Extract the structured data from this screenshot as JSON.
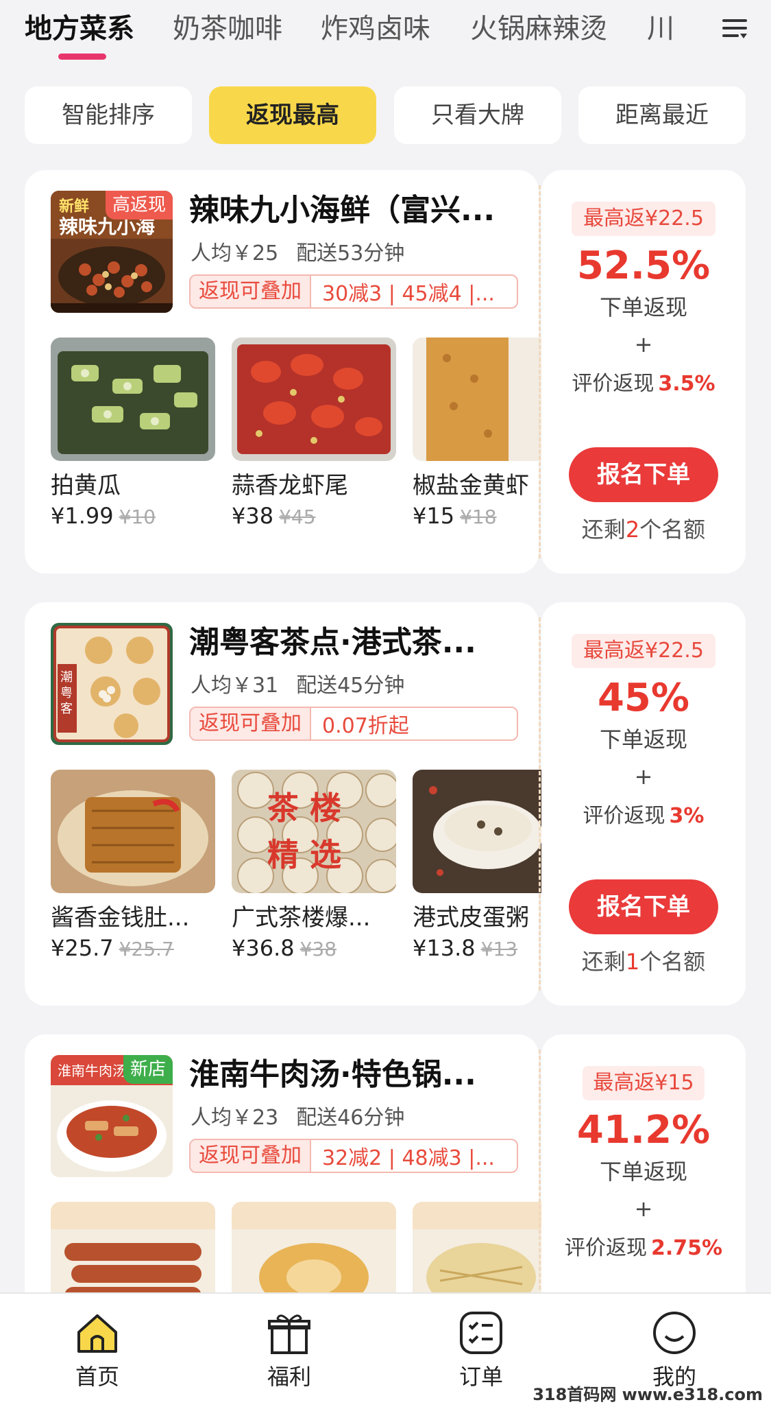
{
  "category_tabs": [
    {
      "label": "地方菜系",
      "active": true
    },
    {
      "label": "奶茶咖啡",
      "active": false
    },
    {
      "label": "炸鸡卤味",
      "active": false
    },
    {
      "label": "火锅麻辣烫",
      "active": false
    },
    {
      "label": "川",
      "active": false
    }
  ],
  "sort_chips": [
    {
      "label": "智能排序",
      "active": false
    },
    {
      "label": "返现最高",
      "active": true
    },
    {
      "label": "只看大牌",
      "active": false
    },
    {
      "label": "距离最近",
      "active": false
    }
  ],
  "stores": [
    {
      "badge": "高返现",
      "name": "辣味九小海鲜（富兴...",
      "avg_price": "人均￥25",
      "delivery": "配送53分钟",
      "promo_tag": "返现可叠加",
      "promo_text": "30减3 | 45减4 |...",
      "dishes": [
        {
          "name": "拍黄瓜",
          "price": "¥1.99",
          "orig": "¥10"
        },
        {
          "name": "蒜香龙虾尾",
          "price": "¥38",
          "orig": "¥45"
        },
        {
          "name": "椒盐金黄虾",
          "price": "¥15",
          "orig": "¥18"
        }
      ],
      "max_return": "最高返¥22.5",
      "rate": "52.5%",
      "rate_label": "下单返现",
      "plus": "+",
      "review_label": "评价返现",
      "review_pct": "3.5%",
      "signup_label": "报名下单",
      "quota_prefix": "还剩",
      "quota_num": "2",
      "quota_suffix": "个名额"
    },
    {
      "badge": "",
      "name": "潮粤客茶点·港式茶...",
      "avg_price": "人均￥31",
      "delivery": "配送45分钟",
      "promo_tag": "返现可叠加",
      "promo_text": "0.07折起",
      "dishes": [
        {
          "name": "酱香金钱肚...",
          "price": "¥25.7",
          "orig": "¥25.7"
        },
        {
          "name": "广式茶楼爆...",
          "price": "¥36.8",
          "orig": "¥38"
        },
        {
          "name": "港式皮蛋粥",
          "price": "¥13.8",
          "orig": "¥13"
        }
      ],
      "dish_overlay": {
        "text1": "茶 楼",
        "text2": "精 选"
      },
      "max_return": "最高返¥22.5",
      "rate": "45%",
      "rate_label": "下单返现",
      "plus": "+",
      "review_label": "评价返现",
      "review_pct": "3%",
      "signup_label": "报名下单",
      "quota_prefix": "还剩",
      "quota_num": "1",
      "quota_suffix": "个名额"
    },
    {
      "badge": "新店",
      "name": "淮南牛肉汤·特色锅...",
      "avg_price": "人均￥23",
      "delivery": "配送46分钟",
      "promo_tag": "返现可叠加",
      "promo_text": "32减2 | 48减3 |...",
      "dishes": [
        {
          "name": "",
          "price": "",
          "orig": ""
        },
        {
          "name": "",
          "price": "",
          "orig": ""
        },
        {
          "name": "",
          "price": "",
          "orig": ""
        }
      ],
      "max_return": "最高返¥15",
      "rate": "41.2%",
      "rate_label": "下单返现",
      "plus": "+",
      "review_label": "评价返现",
      "review_pct": "2.75%"
    }
  ],
  "bottom_nav": [
    {
      "label": "首页",
      "icon": "home-icon",
      "active": true
    },
    {
      "label": "福利",
      "icon": "gift-icon",
      "active": false
    },
    {
      "label": "订单",
      "icon": "order-list-icon",
      "active": false
    },
    {
      "label": "我的",
      "icon": "smile-face-icon",
      "active": false
    }
  ],
  "watermark": "318首码网 www.e318.com",
  "colors": {
    "accent_yellow": "#f8d84a",
    "accent_red": "#e8392f",
    "tab_underline": "#e8356b",
    "badge_green": "#3eae4b"
  }
}
